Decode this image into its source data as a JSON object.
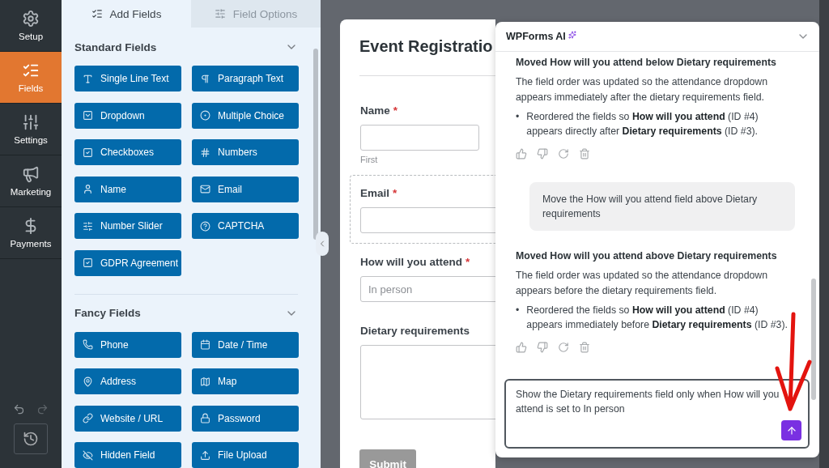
{
  "nav": [
    {
      "label": "Setup",
      "selected": false
    },
    {
      "label": "Fields",
      "selected": true
    },
    {
      "label": "Settings",
      "selected": false
    },
    {
      "label": "Marketing",
      "selected": false
    },
    {
      "label": "Payments",
      "selected": false
    }
  ],
  "panel_tabs": [
    {
      "label": "Add Fields",
      "selected": true
    },
    {
      "label": "Field Options",
      "selected": false
    }
  ],
  "field_groups": [
    {
      "title": "Standard Fields",
      "expanded": true,
      "fields": [
        "Single Line Text",
        "Paragraph Text",
        "Dropdown",
        "Multiple Choice",
        "Checkboxes",
        "Numbers",
        "Name",
        "Email",
        "Number Slider",
        "CAPTCHA",
        "GDPR Agreement"
      ]
    },
    {
      "title": "Fancy Fields",
      "expanded": true,
      "fields": [
        "Phone",
        "Date / Time",
        "Address",
        "Map",
        "Website / URL",
        "Password",
        "Hidden Field",
        "File Upload"
      ]
    }
  ],
  "form": {
    "title": "Event Registratio",
    "fields": [
      {
        "kind": "name",
        "label": "Name",
        "required": true,
        "selected": false,
        "sublabel": "First"
      },
      {
        "kind": "text",
        "label": "Email",
        "required": true,
        "selected": true
      },
      {
        "kind": "select",
        "label": "How will you attend",
        "required": true,
        "selected": false,
        "placeholder": "In person"
      },
      {
        "kind": "textarea",
        "label": "Dietary requirements",
        "required": false,
        "selected": false
      }
    ],
    "submit": "Submit",
    "required_mark": "*"
  },
  "ai_panel": {
    "title": "WPForms AI",
    "messages": [
      {
        "kind": "assistant",
        "title": "Moved How will you attend below Dietary requirements",
        "text": "The field order was updated so the attendance dropdown appears immediately after the dietary requirements field.",
        "bullet_mark": "•",
        "bullets": [
          "Reordered the fields so **How will you attend** (ID #4) appears directly after **Dietary requirements** (ID #3)."
        ]
      },
      {
        "kind": "user",
        "text": "Move the How will you attend field above Dietary requirements"
      },
      {
        "kind": "assistant",
        "title": "Moved How will you attend above Dietary requirements",
        "text": "The field order was updated so the attendance dropdown appears before the dietary requirements field.",
        "bullet_mark": "•",
        "bullets": [
          "Reordered the fields so **How will you attend** (ID #4) appears immediately before **Dietary requirements** (ID #3)."
        ]
      }
    ],
    "input": "Show the Dietary requirements field only when How will you attend is set to In person"
  }
}
